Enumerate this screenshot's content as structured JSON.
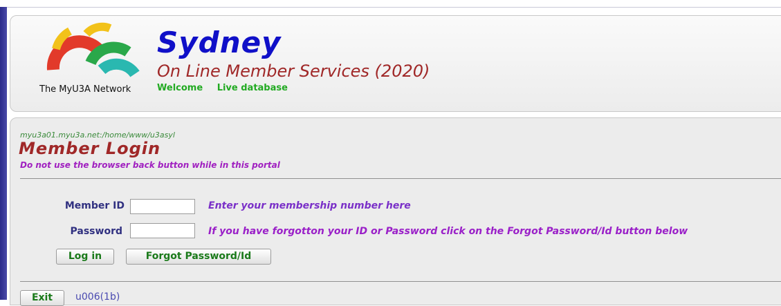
{
  "header": {
    "network_label": "The MyU3A Network",
    "site_title": "Sydney",
    "site_subtitle": "On Line Member Services (2020)",
    "welcome": "Welcome",
    "database": "Live database"
  },
  "main": {
    "server_path": "myu3a01.myu3a.net:/home/www/u3asyl",
    "title": "Member Login",
    "warning": "Do not use the browser back button while in this portal"
  },
  "form": {
    "member_id_label": "Member ID",
    "member_id_value": "",
    "member_id_hint": "Enter your membership number here",
    "password_label": "Password",
    "password_value": "",
    "password_hint": "If you have forgotton your ID or Password click on the Forgot Password/Id button below",
    "login_button": "Log in",
    "forgot_button": "Forgot Password/Id"
  },
  "footer": {
    "exit_button": "Exit",
    "version": "u006(1b)"
  },
  "colors": {
    "title_blue": "#1010c8",
    "accent_red": "#a02828",
    "status_green": "#22aa22",
    "hint_purple": "#9a20c8"
  }
}
